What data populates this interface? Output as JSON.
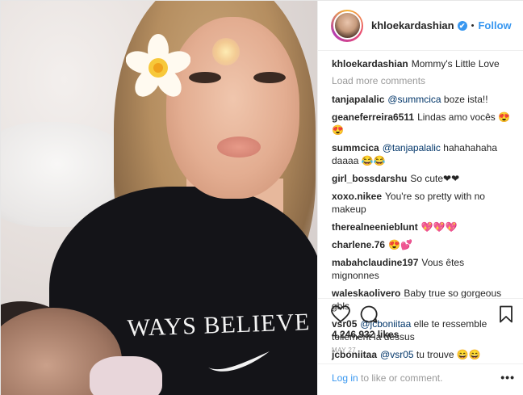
{
  "header": {
    "username": "khloekardashian",
    "verified_glyph": "✔",
    "separator": "•",
    "follow_label": "Follow"
  },
  "photo": {
    "shirt_text": "WAYS BELIEVE"
  },
  "caption": {
    "username": "khloekardashian",
    "text": "Mommy's Little Love"
  },
  "load_more_label": "Load more comments",
  "comments": [
    {
      "user": "tanjapalalic",
      "mention": "@summcica",
      "text": "boze ista!!"
    },
    {
      "user": "geaneferreira6511",
      "mention": "",
      "text": "Lindas amo vocês 😍😍"
    },
    {
      "user": "summcica",
      "mention": "@tanjapalalic",
      "text": "hahahahaha daaaa 😂😂"
    },
    {
      "user": "girl_bossdarshu",
      "mention": "",
      "text": "So cute❤❤"
    },
    {
      "user": "xoxo.nikee",
      "mention": "",
      "text": "You're so pretty with no makeup"
    },
    {
      "user": "therealneenieblunt",
      "mention": "",
      "text": "💖💖💖"
    },
    {
      "user": "charlene.76",
      "mention": "",
      "text": "😍💕"
    },
    {
      "user": "mabahclaudine197",
      "mention": "",
      "text": "Vous êtes mignonnes"
    },
    {
      "user": "waleskaolivero",
      "mention": "",
      "text": "Baby true so gorgeous gbls"
    },
    {
      "user": "vsr05",
      "mention": "@jcboniitaa",
      "text": "elle te ressemble tellement la dessus"
    },
    {
      "user": "jcboniitaa",
      "mention": "@vsr05",
      "text": "tu trouve 😄😄"
    }
  ],
  "actions": {
    "like_icon": "heart-outline-icon",
    "comment_icon": "speech-bubble-icon",
    "save_icon": "bookmark-icon"
  },
  "likes_text": "4,246,932 likes",
  "date_text": "MAY 27",
  "login": {
    "link_label": "Log in",
    "suffix": " to like or comment.",
    "more_label": "•••"
  },
  "colors": {
    "accent_blue": "#3897f0",
    "text": "#262626",
    "muted": "#999999",
    "mention": "#003569"
  }
}
